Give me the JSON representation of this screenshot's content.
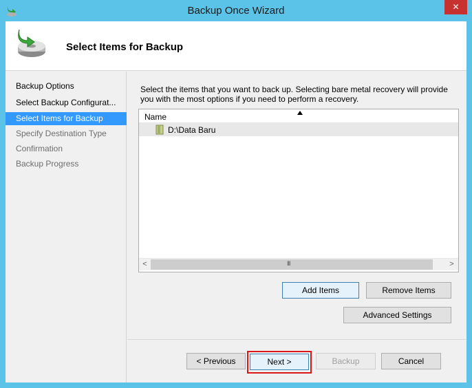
{
  "window": {
    "title": "Backup Once Wizard",
    "close_glyph": "✕"
  },
  "header": {
    "title": "Select Items for Backup"
  },
  "nav": {
    "items": [
      {
        "label": "Backup Options",
        "state": "done"
      },
      {
        "label": "Select Backup Configurat...",
        "state": "done"
      },
      {
        "label": "Select Items for Backup",
        "state": "current"
      },
      {
        "label": "Specify Destination Type",
        "state": "pending"
      },
      {
        "label": "Confirmation",
        "state": "pending"
      },
      {
        "label": "Backup Progress",
        "state": "pending"
      }
    ]
  },
  "main": {
    "description": "Select the items that you want to back up. Selecting bare metal recovery will provide you with the most options if you need to perform a recovery.",
    "list": {
      "column": "Name",
      "rows": [
        {
          "label": "D:\\Data Baru",
          "icon": "folder-icon"
        }
      ],
      "scroll_left": "<",
      "scroll_right": ">",
      "scroll_grip": "III"
    },
    "buttons": {
      "add_items": "Add Items",
      "remove_items": "Remove Items",
      "advanced_settings": "Advanced Settings"
    }
  },
  "footer": {
    "previous": "< Previous",
    "next": "Next >",
    "backup": "Backup",
    "cancel": "Cancel"
  },
  "colors": {
    "title_bar": "#5bc3e8",
    "selected_nav": "#3399ff",
    "close_button": "#c7312f",
    "highlight_box": "#d9161a"
  }
}
